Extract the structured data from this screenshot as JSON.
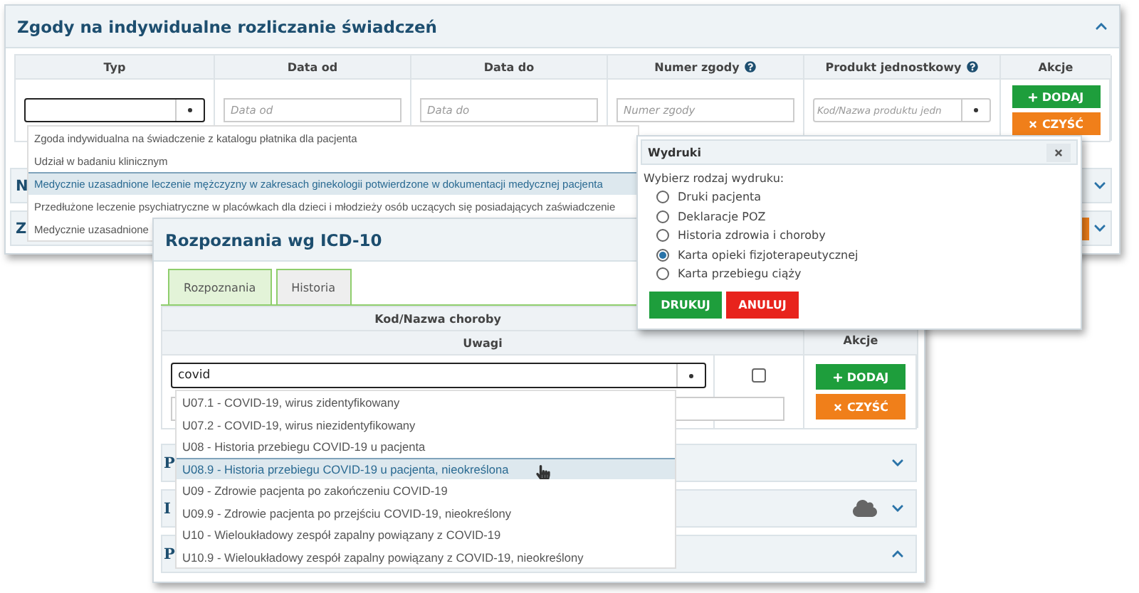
{
  "consent_window": {
    "title": "Zgody na indywidualne rozliczanie świadczeń",
    "expanded": true,
    "columns": [
      {
        "label": "Typ",
        "help": false
      },
      {
        "label": "Data od",
        "help": false
      },
      {
        "label": "Data do",
        "help": false
      },
      {
        "label": "Numer zgody",
        "help": true
      },
      {
        "label": "Produkt jednostkowy",
        "help": true
      },
      {
        "label": "Akcje",
        "help": false
      }
    ],
    "fields": [
      {
        "placeholder": "Data od"
      },
      {
        "placeholder": "Data do"
      },
      {
        "placeholder": "Numer zgody"
      },
      {
        "placeholder": "Kod/Nazwa produktu jedn"
      }
    ],
    "buttons": [
      {
        "label": "DODAJ",
        "kind": "add"
      },
      {
        "label": "CZYŚĆ",
        "kind": "clear"
      }
    ],
    "type_options": [
      {
        "label": "Zgoda indywidualna na świadczenie z katalogu płatnika dla pacjenta",
        "selected": false
      },
      {
        "label": "Udział w badaniu klinicznym",
        "selected": false
      },
      {
        "label": "Medycznie uzasadnione leczenie mężczyzny w zakresach ginekologii potwierdzone w dokumentacji medycznej pacjenta",
        "selected": true
      },
      {
        "label": "Przedłużone leczenie psychiatryczne w placówkach dla dzieci i młodzieży osób uczących się posiadających zaświadczenie",
        "selected": false
      },
      {
        "label": "Medycznie uzasadnione",
        "selected": false
      }
    ],
    "sections": [
      {
        "title": "N",
        "expanded": false
      },
      {
        "title": "Z",
        "expanded": false
      }
    ]
  },
  "diagnosis_window": {
    "title": "Rozpoznania wg ICD-10",
    "tabs": [
      {
        "label": "Rozpoznania",
        "selected": true
      },
      {
        "label": "Historia",
        "selected": false
      }
    ],
    "columns": [
      "Kod/Nazwa choroby",
      "Uwagi",
      "Akcje"
    ],
    "search": {
      "value": "covid"
    },
    "checkbox": {
      "checked": false
    },
    "buttons": [
      {
        "label": "DODAJ",
        "kind": "add"
      },
      {
        "label": "CZYŚĆ",
        "kind": "clear"
      }
    ],
    "suggestions": [
      {
        "label": "U07.1 - COVID-19, wirus zidentyfikowany",
        "selected": false
      },
      {
        "label": "U07.2 - COVID-19, wirus niezidentyfikowany",
        "selected": false
      },
      {
        "label": "U08 - Historia przebiegu COVID-19 u pacjenta",
        "selected": false
      },
      {
        "label": "U08.9 - Historia przebiegu COVID-19 u pacjenta, nieokreślona",
        "selected": true
      },
      {
        "label": "U09 - Zdrowie pacjenta po zakończeniu COVID-19",
        "selected": false
      },
      {
        "label": "U09.9 - Zdrowie pacjenta po przejściu COVID-19, nieokreślony",
        "selected": false
      },
      {
        "label": "U10 - Wieloukładowy zespół zapalny powiązany z COVID-19",
        "selected": false
      },
      {
        "label": "U10.9 - Wieloukładowy zespół zapalny powiązany z COVID-19, nieokreślony",
        "selected": false
      }
    ],
    "sections": [
      {
        "title": "P",
        "expanded": false,
        "cloud": false
      },
      {
        "title": "I",
        "expanded": false,
        "cloud": true
      },
      {
        "title": "P",
        "expanded": true,
        "cloud": false
      }
    ]
  },
  "print_dialog": {
    "title": "Wydruki",
    "prompt": "Wybierz rodzaj wydruku:",
    "options": [
      {
        "label": "Druki pacjenta",
        "selected": false
      },
      {
        "label": "Deklaracje POZ",
        "selected": false
      },
      {
        "label": "Historia zdrowia i choroby",
        "selected": false
      },
      {
        "label": "Karta opieki fizjoterapeutycznej",
        "selected": true
      },
      {
        "label": "Karta przebiegu ciąży",
        "selected": false
      }
    ],
    "buttons": [
      {
        "label": "DRUKUJ",
        "kind": "confirm"
      },
      {
        "label": "ANULUJ",
        "kind": "cancel"
      }
    ]
  }
}
